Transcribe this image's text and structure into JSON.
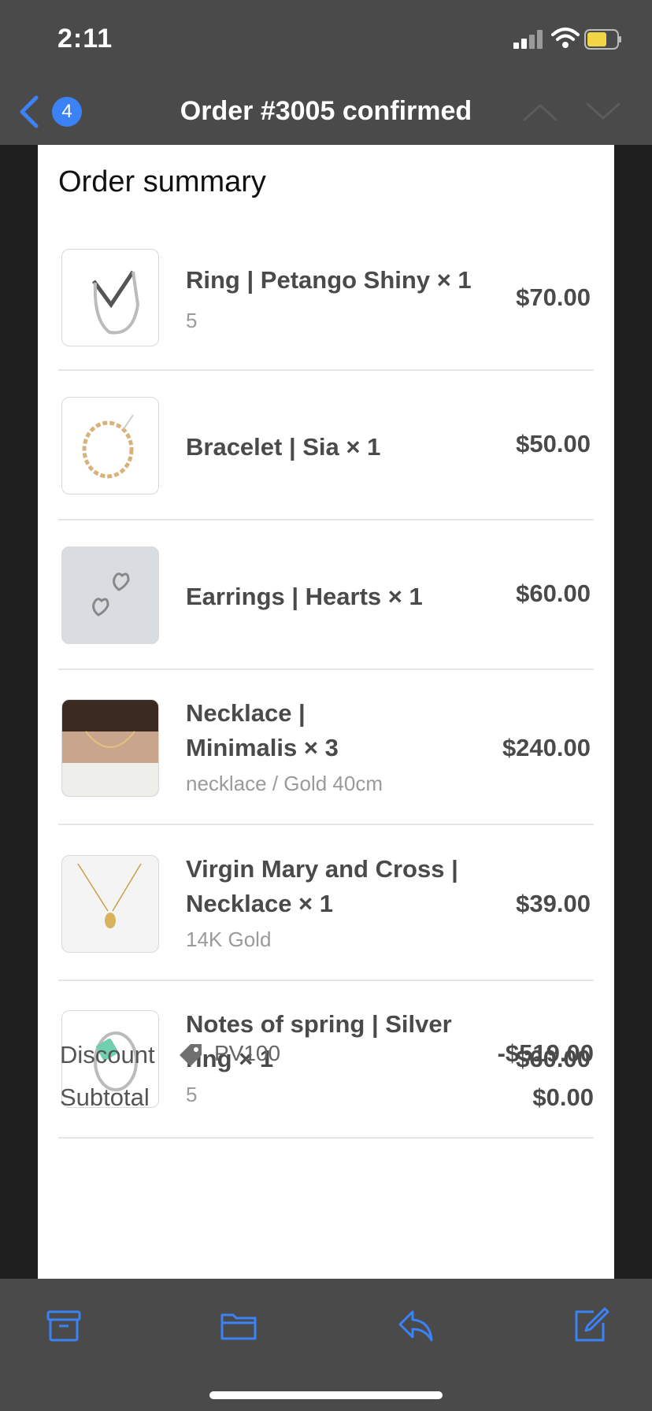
{
  "status": {
    "time": "2:11"
  },
  "nav": {
    "badge": "4",
    "title": "Order #3005 confirmed"
  },
  "summary": {
    "title": "Order summary",
    "items": [
      {
        "name": "Ring | Petango Shiny × 1",
        "variant": "5",
        "price": "$70.00",
        "thumb": "ring-image"
      },
      {
        "name": "Bracelet | Sia × 1",
        "variant": "",
        "price": "$50.00",
        "thumb": "bracelet-image"
      },
      {
        "name": "Earrings | Hearts × 1",
        "variant": "",
        "price": "$60.00",
        "thumb": "earrings-image"
      },
      {
        "name": "Necklace | Minimalis × 3",
        "variant": "necklace / Gold 40cm",
        "price": "$240.00",
        "thumb": "necklace-image"
      },
      {
        "name": "Virgin Mary and Cross | Necklace × 1",
        "variant": "14K Gold",
        "price": "$39.00",
        "thumb": "pendant-image"
      },
      {
        "name": "Notes of spring | Silver ring × 1",
        "variant": "5",
        "price": "$60.00",
        "thumb": "green-ring-image"
      }
    ],
    "discount": {
      "label": "Discount",
      "code": "PV100",
      "value": "-$519.00"
    },
    "subtotal": {
      "label": "Subtotal",
      "value": "$0.00"
    }
  },
  "colors": {
    "accent": "#3b82f6",
    "bar": "#4a4a4a"
  },
  "toolbar": {
    "icons": [
      "archive-icon",
      "folder-icon",
      "reply-icon",
      "compose-icon"
    ]
  }
}
